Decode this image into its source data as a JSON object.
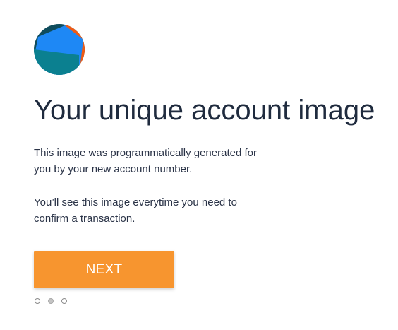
{
  "account_image": {
    "icon": "account-identicon",
    "colors": [
      "#0f4c5c",
      "#1e88f5",
      "#0b8090",
      "#f05a14"
    ]
  },
  "title": "Your unique account image",
  "paragraph_1": "This image was programmatically generated for you by your new account number.",
  "paragraph_2": "You’ll see this image everytime you need to confirm a transaction.",
  "next_button": {
    "label": "NEXT",
    "color": "#f7952f"
  },
  "pagination": {
    "total": 3,
    "active_index": 1
  }
}
